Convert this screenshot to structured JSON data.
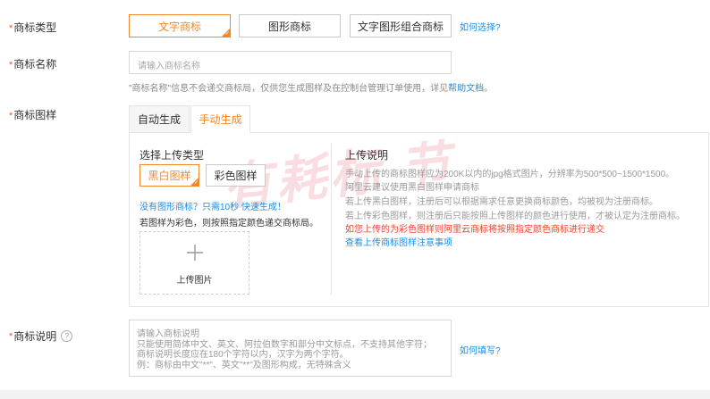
{
  "required_mark": "*",
  "trademark_type": {
    "label": "商标类型",
    "options": [
      "文字商标",
      "图形商标",
      "文字图形组合商标"
    ],
    "selected": "文字商标",
    "help_link": "如何选择?"
  },
  "trademark_name": {
    "label": "商标名称",
    "placeholder": "请输入商标名称",
    "note_prefix": "\"商标名称\"信息不会递交商标局，仅供您生成图样及在控制台管理订单使用，详见",
    "note_link": "帮助文档",
    "note_suffix": "。"
  },
  "trademark_image": {
    "label": "商标图样",
    "tabs": [
      "自动生成",
      "手动生成"
    ],
    "active_tab": "手动生成",
    "upload_type_title": "选择上传类型",
    "color_options": [
      "黑白图样",
      "彩色图样"
    ],
    "selected_color": "黑白图样",
    "no_image_link": "没有图形商标？只需10秒 快速生成！",
    "color_note": "若图样为彩色，则按照指定颜色递交商标局。",
    "upload_label": "上传图片",
    "instructions_title": "上传说明",
    "instructions": [
      "手动上传的商标图样应为200K以内的jpg格式图片，分辨率为500*500~1500*1500。",
      "阿里云建议使用黑白图样申请商标",
      "若上传黑白图样，注册后可以根据需求任意更换商标颜色，均被视为注册商标。",
      "若上传彩色图样，则注册后只能按照上传图样的颜色进行使用，才被认定为注册商标。"
    ],
    "warning": "如您上传的为彩色图样则阿里云商标将按照指定颜色商标进行递交",
    "notes_link": "查看上传商标图样注意事项"
  },
  "trademark_desc": {
    "label": "商标说明",
    "help_icon": "?",
    "placeholder_lines": [
      "请输入商标说明",
      "只能使用简体中文、英文、阿拉伯数字和部分中文标点，不支持其他字符；",
      "商标说明长度应在180个字符以内，汉字为两个字符。",
      "例：商标由中文\"**\"、英文\"**\"及图形构成，无特殊含义"
    ],
    "help_link": "如何填写?"
  },
  "watermark": "有耗标 节"
}
